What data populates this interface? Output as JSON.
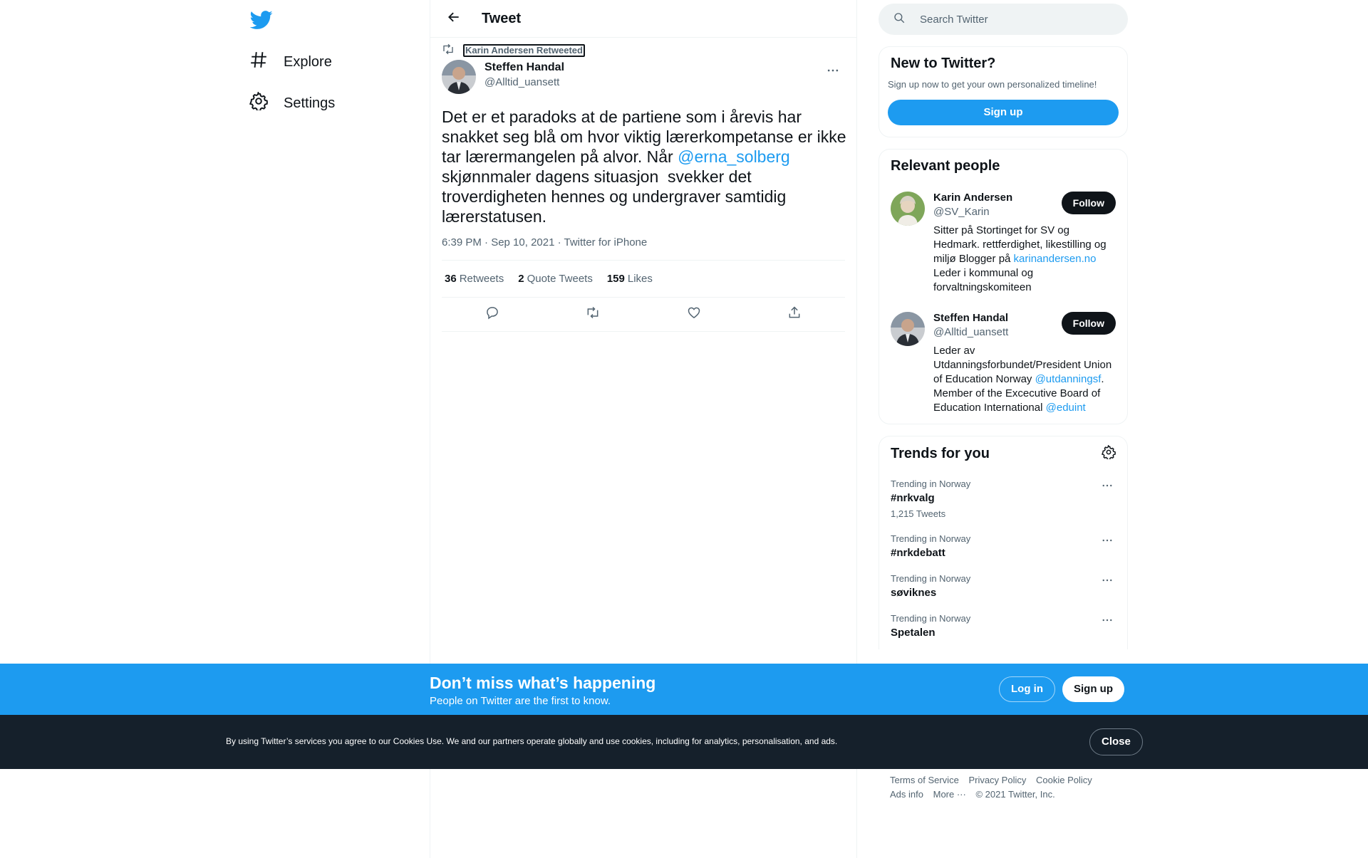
{
  "nav": {
    "explore": "Explore",
    "settings": "Settings"
  },
  "header": {
    "title": "Tweet"
  },
  "tweet": {
    "retweeted_by": "Karin Andersen Retweeted",
    "author_name": "Steffen Handal",
    "author_handle": "@Alltid_uansett",
    "text_part1": "Det er et paradoks at de partiene som i årevis har snakket seg blå om hvor viktig lærerkompetanse er ikke tar lærermangelen på alvor. Når ",
    "mention": "@erna_solberg",
    "text_part2": " skjønnmaler dagens situasjon  svekker det troverdigheten hennes og undergraver samtidig lærerstatusen.",
    "time": "6:39 PM · Sep 10, 2021",
    "separator": " · ",
    "source": "Twitter for iPhone",
    "retweets_count": "36",
    "retweets_label": "Retweets",
    "quotes_count": "2",
    "quotes_label": "Quote Tweets",
    "likes_count": "159",
    "likes_label": "Likes"
  },
  "search": {
    "placeholder": "Search Twitter"
  },
  "new_to_twitter": {
    "title": "New to Twitter?",
    "subtitle": "Sign up now to get your own personalized timeline!",
    "signup": "Sign up"
  },
  "relevant_people": {
    "title": "Relevant people",
    "people": [
      {
        "name": "Karin Andersen",
        "handle": "@SV_Karin",
        "follow": "Follow",
        "bio_part1": "Sitter på Stortinget for SV og Hedmark. rettferdighet, likestilling og miljø Blogger på ",
        "bio_link": "karinandersen.no",
        "bio_part2": " Leder i kommunal og forvaltningskomiteen"
      },
      {
        "name": "Steffen Handal",
        "handle": "@Alltid_uansett",
        "follow": "Follow",
        "bio_part1": "Leder av Utdanningsforbundet/President Union of Education Norway ",
        "bio_link": "@utdanningsf",
        "bio_part2": ". Member of the Excecutive Board of Education International ",
        "bio_link2": "@eduint"
      }
    ]
  },
  "trends": {
    "title": "Trends for you",
    "items": [
      {
        "context": "Trending in Norway",
        "name": "#nrkvalg",
        "count": "1,215 Tweets"
      },
      {
        "context": "Trending in Norway",
        "name": "#nrkdebatt"
      },
      {
        "context": "Trending in Norway",
        "name": "søviknes"
      },
      {
        "context": "Trending in Norway",
        "name": "Spetalen"
      }
    ]
  },
  "footer": {
    "terms": "Terms of Service",
    "privacy": "Privacy Policy",
    "cookie": "Cookie Policy",
    "ads": "Ads info",
    "more": "More ···",
    "copyright": "© 2021 Twitter, Inc."
  },
  "banner": {
    "title": "Don’t miss what’s happening",
    "subtitle": "People on Twitter are the first to know.",
    "login": "Log in",
    "signup": "Sign up"
  },
  "cookie_bar": {
    "text": "By using Twitter’s services you agree to our Cookies Use. We and our partners operate globally and use cookies, including for analytics, personalisation, and ads.",
    "close": "Close"
  },
  "colors": {
    "accent": "#1d9bf0",
    "text": "#0f1419",
    "secondary": "#536471",
    "cookie_bg": "#15202b"
  },
  "icons": [
    "twitter-logo-icon",
    "hashtag-icon",
    "gear-icon",
    "back-arrow-icon",
    "retweet-icon",
    "more-icon",
    "reply-icon",
    "like-icon",
    "share-icon",
    "search-icon"
  ]
}
